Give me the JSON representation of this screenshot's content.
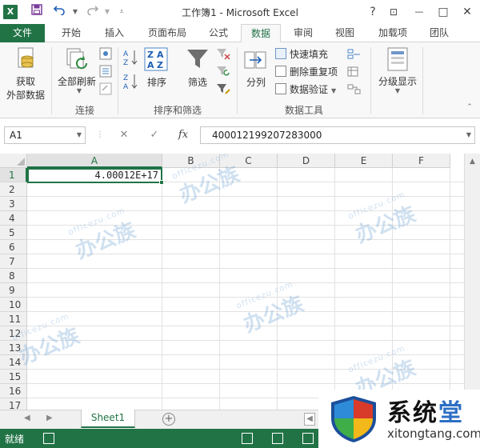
{
  "window": {
    "title": "工作簿1 - Microsoft Excel",
    "help": "?",
    "restore_ribbon": "⊡",
    "minimize": "—",
    "maximize": "□",
    "close": "✕"
  },
  "quick_access": {
    "app_icon": "X",
    "save_icon": "save-icon",
    "undo_icon": "undo-icon",
    "redo_icon": "redo-icon",
    "customize_icon": "customize-icon"
  },
  "tabs": [
    {
      "label": "文件"
    },
    {
      "label": "开始"
    },
    {
      "label": "插入"
    },
    {
      "label": "页面布局"
    },
    {
      "label": "公式"
    },
    {
      "label": "数据"
    },
    {
      "label": "审阅"
    },
    {
      "label": "视图"
    },
    {
      "label": "加载项"
    },
    {
      "label": "团队"
    }
  ],
  "ribbon": {
    "get_external_data": {
      "line1": "获取",
      "line2": "外部数据"
    },
    "refresh_all": "全部刷新",
    "group_connections": "连接",
    "sort": "排序",
    "filter": "筛选",
    "group_sort_filter": "排序和筛选",
    "text_to_columns": "分列",
    "flash_fill": "快速填充",
    "remove_duplicates": "删除重复项",
    "data_validation": "数据验证",
    "group_data_tools": "数据工具",
    "outline": "分级显示"
  },
  "formula_bar": {
    "name_box": "A1",
    "fx_label": "fx",
    "cancel": "✕",
    "enter": "✓",
    "value": "400012199207283000"
  },
  "sheet": {
    "columns": [
      "A",
      "B",
      "C",
      "D",
      "E",
      "F"
    ],
    "rows": [
      "1",
      "2",
      "3",
      "4",
      "5",
      "6",
      "7",
      "8",
      "9",
      "10",
      "11",
      "12",
      "13",
      "14",
      "15",
      "16",
      "17"
    ],
    "cell_a1": "4.00012E+17"
  },
  "sheet_tabs": {
    "active": "Sheet1",
    "add": "+"
  },
  "status": {
    "text": "就绪"
  },
  "watermark": {
    "brand": "办公族",
    "url": "officezu.com"
  },
  "site_logo": {
    "name_part1": "系统",
    "name_part2": "堂",
    "url": "xitongtang.com"
  },
  "colors": {
    "accent": "#217346",
    "logo_blue": "#2d6fc4"
  }
}
